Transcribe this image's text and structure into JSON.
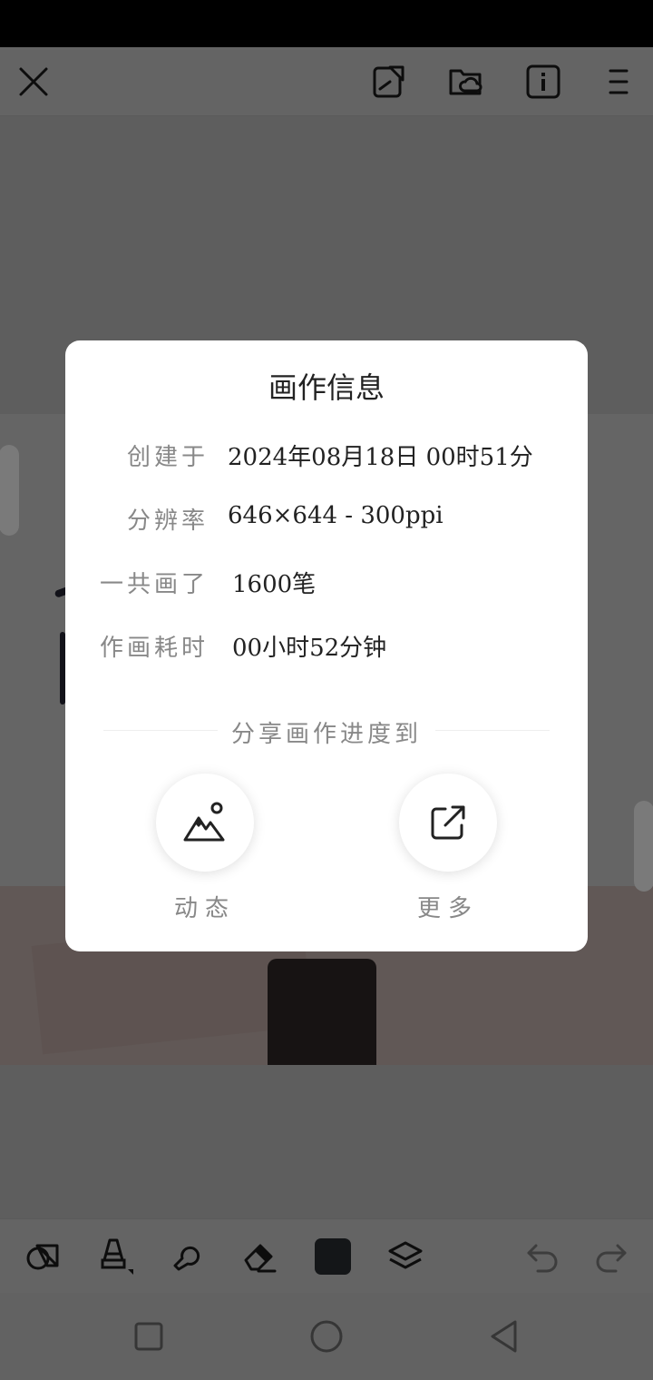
{
  "dialog": {
    "title": "画作信息",
    "rows": [
      {
        "label": "创建于",
        "value": "2024年08月18日 00时51分"
      },
      {
        "label": "分辨率",
        "value": "646×644 - 300ppi"
      },
      {
        "label": "一共画了",
        "value": "1600笔"
      },
      {
        "label": "作画耗时",
        "value": "00小时52分钟"
      }
    ],
    "share_title": "分享画作进度到",
    "share_options": [
      {
        "label": "动态",
        "icon": "mountain-image-icon"
      },
      {
        "label": "更多",
        "icon": "external-share-icon"
      }
    ]
  },
  "toolbar_top": {
    "icons": [
      "close-icon",
      "clipboard-shape-icon",
      "cloud-folder-icon",
      "info-icon",
      "menu-icon"
    ]
  },
  "toolbar_bottom": {
    "icons": [
      "shapes-icon",
      "brush-icon",
      "smudge-icon",
      "eraser-icon",
      "color-swatch-icon",
      "layers-icon",
      "undo-icon",
      "redo-icon"
    ],
    "current_color": "#33373d"
  },
  "colors": {
    "overlay": "rgba(0,0,0,0.6)",
    "dialog_bg": "#ffffff",
    "label": "#888888",
    "value": "#222222"
  }
}
